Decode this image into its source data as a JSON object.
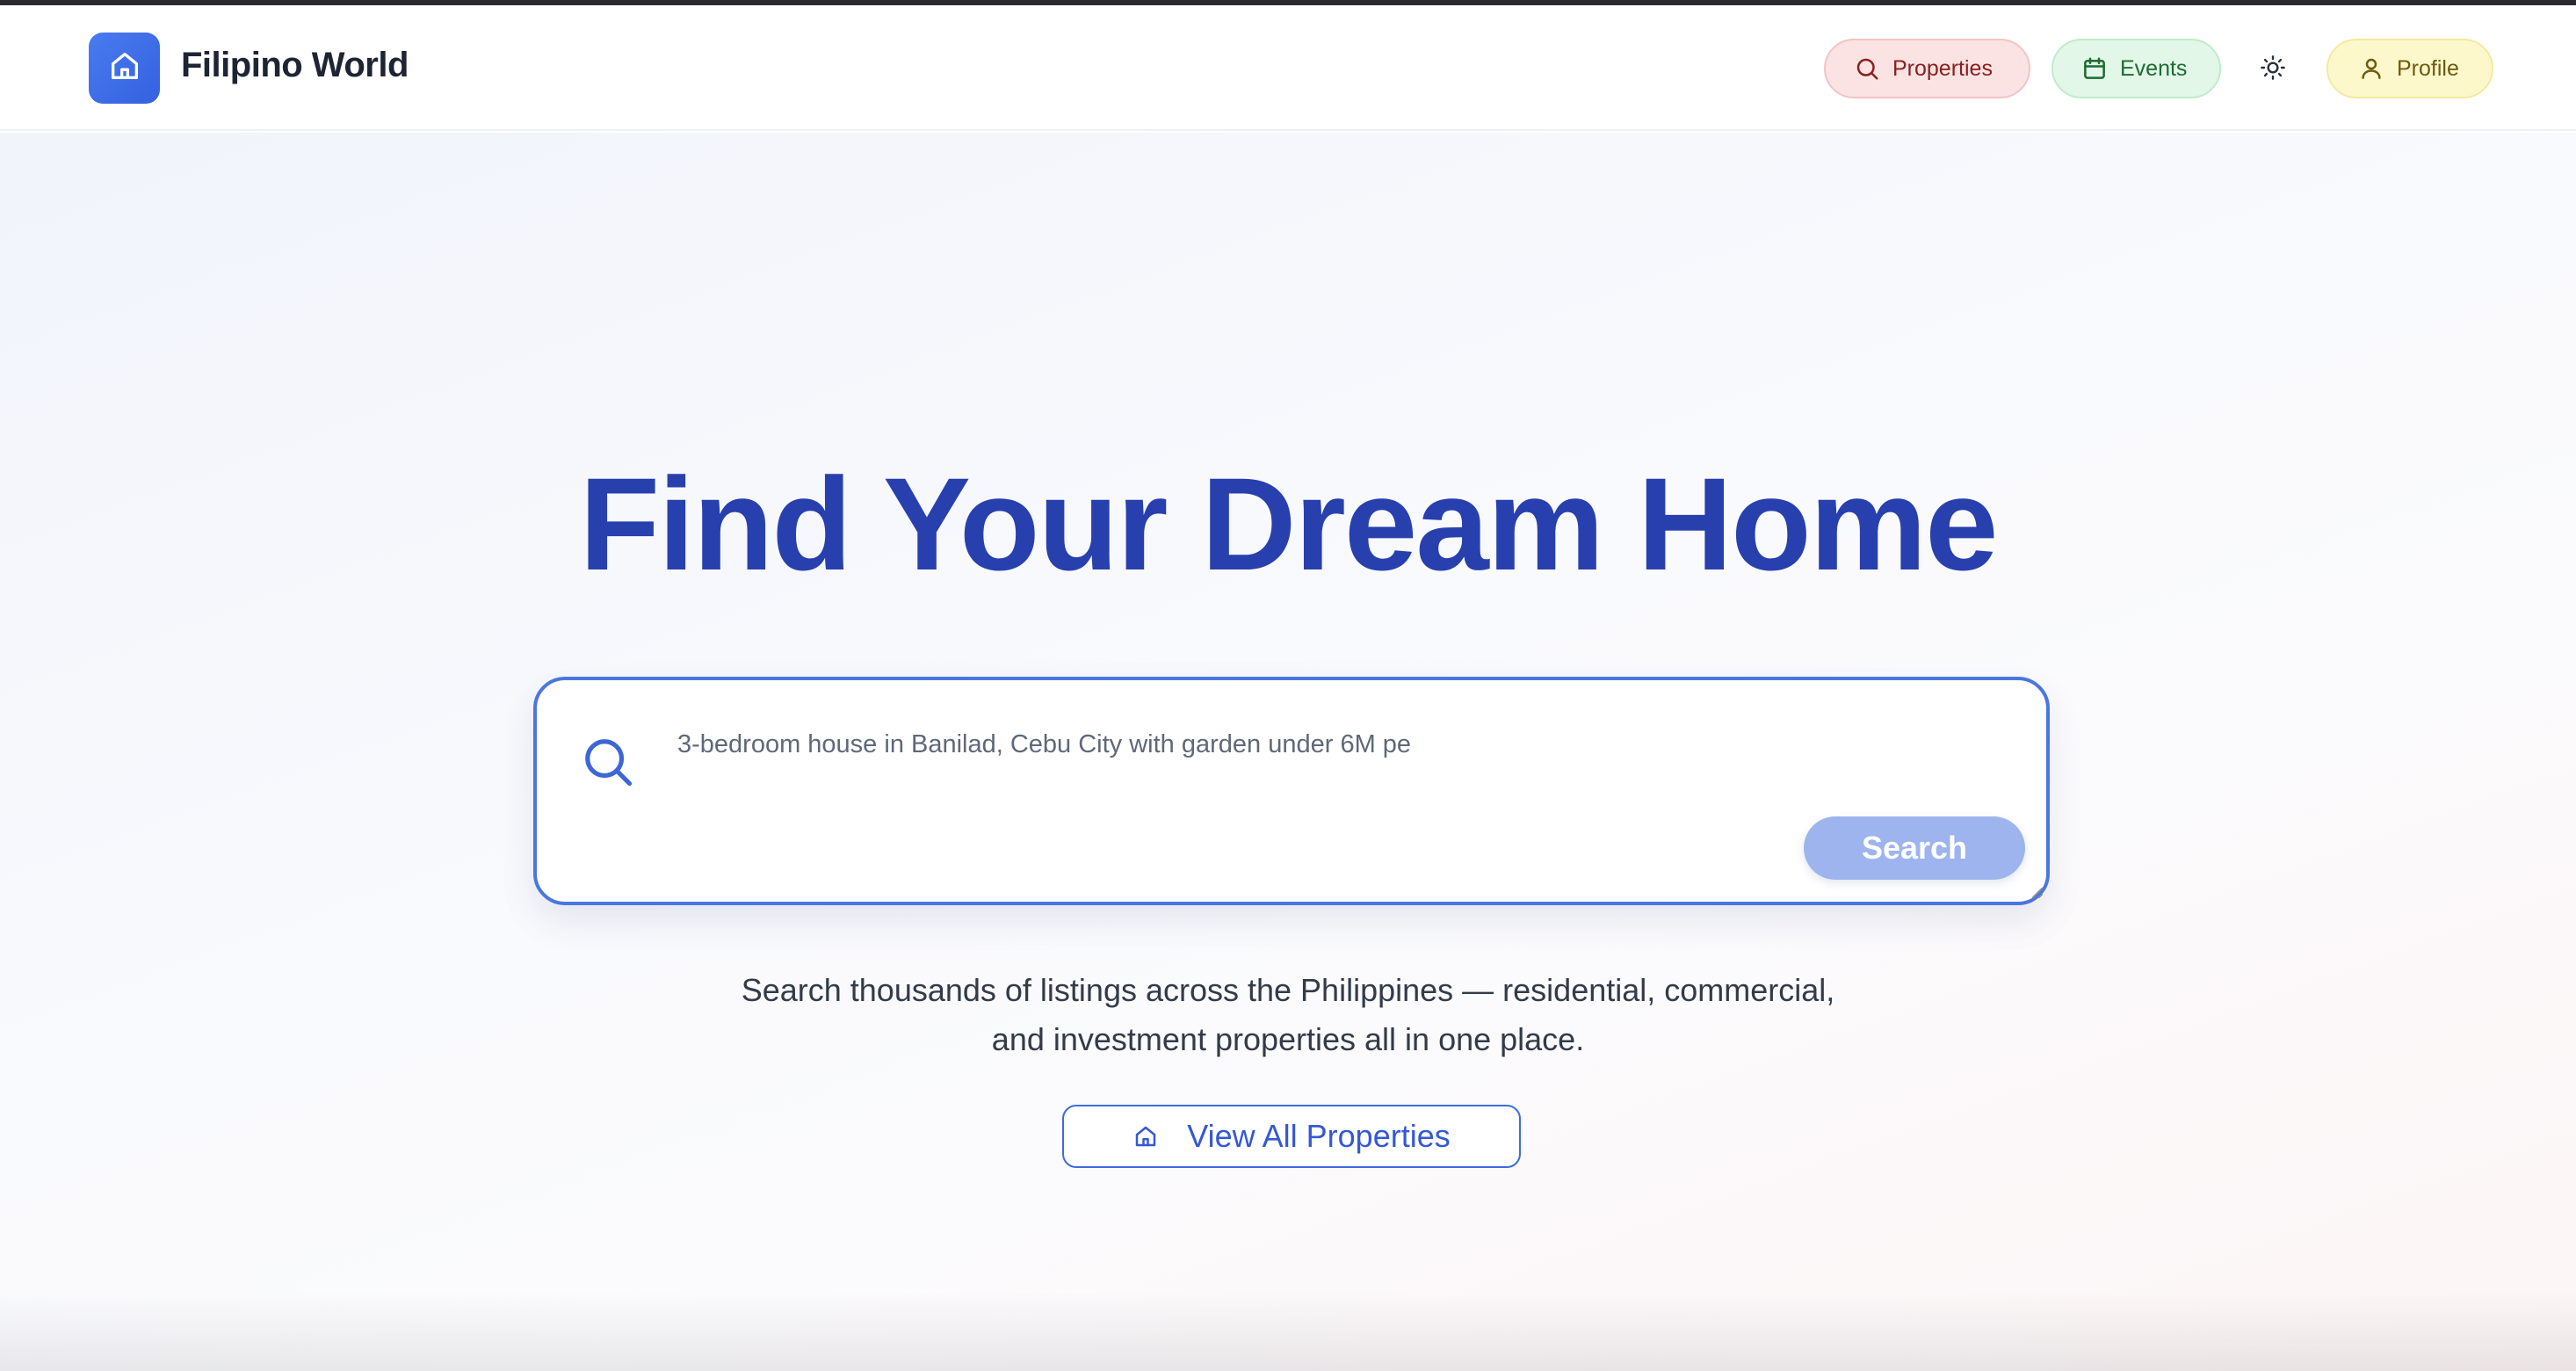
{
  "header": {
    "brand": "Filipino World",
    "nav": {
      "properties_label": "Properties",
      "events_label": "Events",
      "profile_label": "Profile"
    },
    "icons": {
      "logo": "home-icon",
      "properties": "search-icon",
      "events": "calendar-icon",
      "theme": "sun-icon",
      "profile": "user-icon"
    }
  },
  "hero": {
    "title": "Find Your Dream Home",
    "search": {
      "placeholder": "3-bedroom house in Banilad, Cebu City with garden under 6M pe",
      "button_label": "Search",
      "icon": "search-icon"
    },
    "subtitle_line1": "Search thousands of listings across the Philippines — residential, commercial,",
    "subtitle_line2": "and investment properties all in one place.",
    "view_all_label": "View All Properties",
    "view_all_icon": "home-icon"
  },
  "colors": {
    "accent": "#3461e0",
    "title": "#2840ae",
    "search_button": "#9db4ee",
    "properties_pill": "#fbe3e3",
    "events_pill": "#e2f7e7",
    "profile_pill": "#fdf8cc"
  }
}
